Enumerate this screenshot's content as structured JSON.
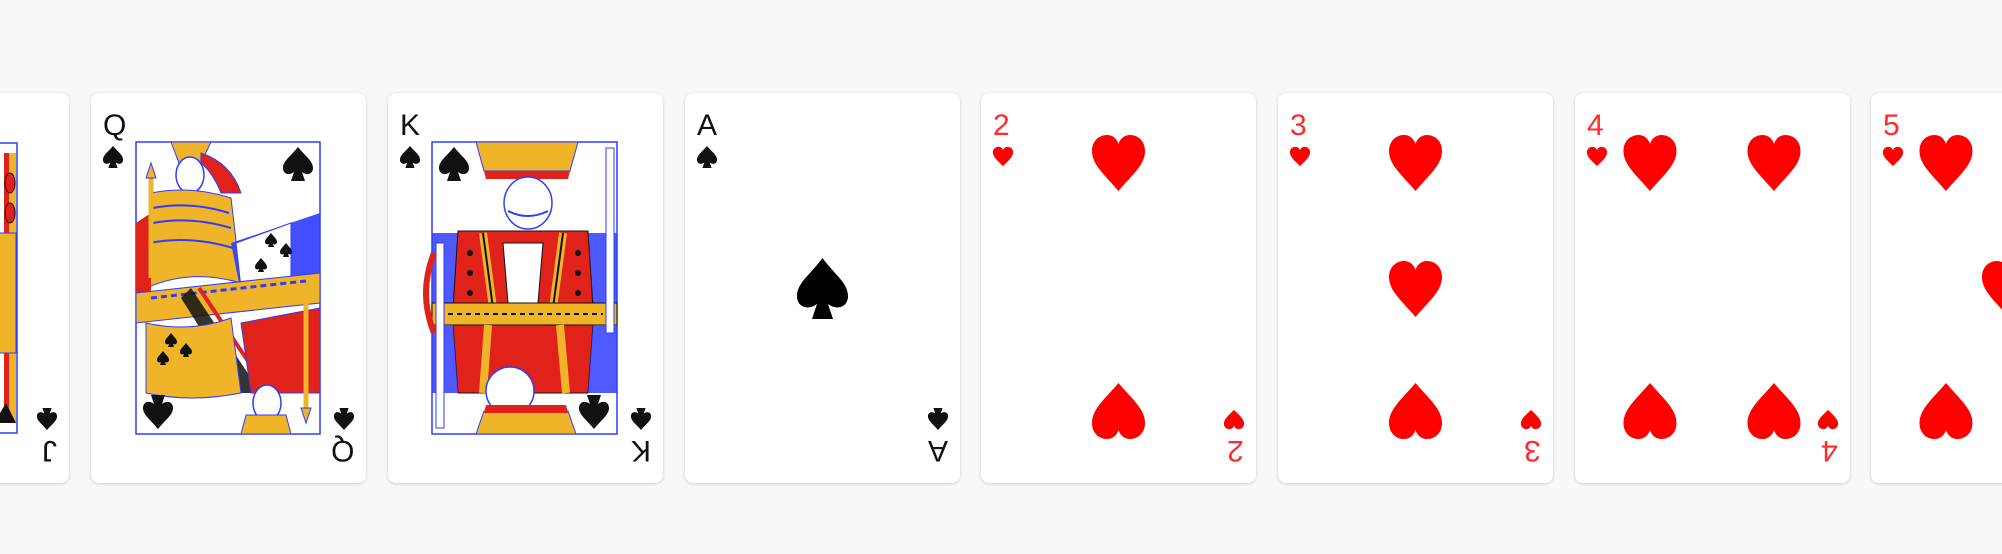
{
  "colors": {
    "red": "#ff0000",
    "black": "#000000",
    "court_blue": "#2f3cff",
    "court_gold": "#f0b429",
    "court_red": "#e0221a",
    "table_bg": "#f8f8f8"
  },
  "cards": [
    {
      "rank": "J",
      "suit": "spades",
      "color": "black",
      "partial": "left"
    },
    {
      "rank": "Q",
      "suit": "spades",
      "color": "black"
    },
    {
      "rank": "K",
      "suit": "spades",
      "color": "black"
    },
    {
      "rank": "A",
      "suit": "spades",
      "color": "black"
    },
    {
      "rank": "2",
      "suit": "hearts",
      "color": "red"
    },
    {
      "rank": "3",
      "suit": "hearts",
      "color": "red"
    },
    {
      "rank": "4",
      "suit": "hearts",
      "color": "red"
    },
    {
      "rank": "5",
      "suit": "hearts",
      "color": "red",
      "partial": "right"
    }
  ]
}
